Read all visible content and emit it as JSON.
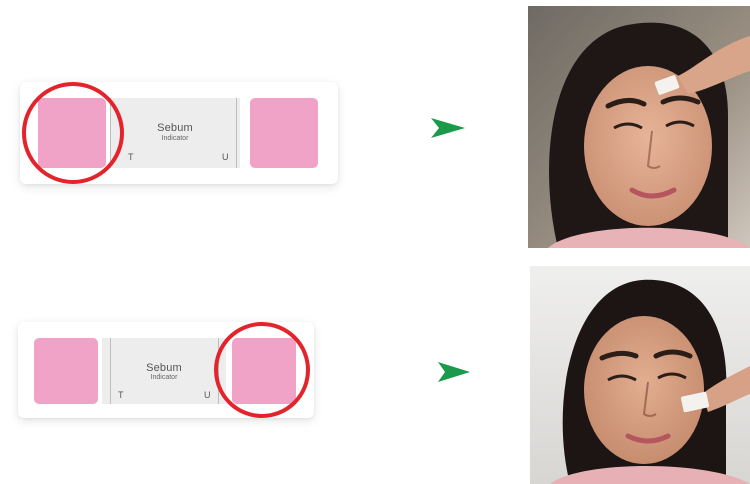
{
  "strips": [
    {
      "title": "Sebum",
      "subtitle": "Indicator",
      "mark_left": "T",
      "mark_right": "U",
      "highlight": "T"
    },
    {
      "title": "Sebum",
      "subtitle": "Indicator",
      "mark_left": "T",
      "mark_right": "U",
      "highlight": "U"
    }
  ],
  "colors": {
    "pad": "#f0a2c7",
    "ring": "#e3242b",
    "arrow": "#1a9a4a",
    "panel": "#ededed"
  },
  "icons": {
    "arrow": "arrow-right-icon"
  },
  "photos": [
    {
      "subject": "forehead-blotting-photo"
    },
    {
      "subject": "cheek-blotting-photo"
    }
  ]
}
